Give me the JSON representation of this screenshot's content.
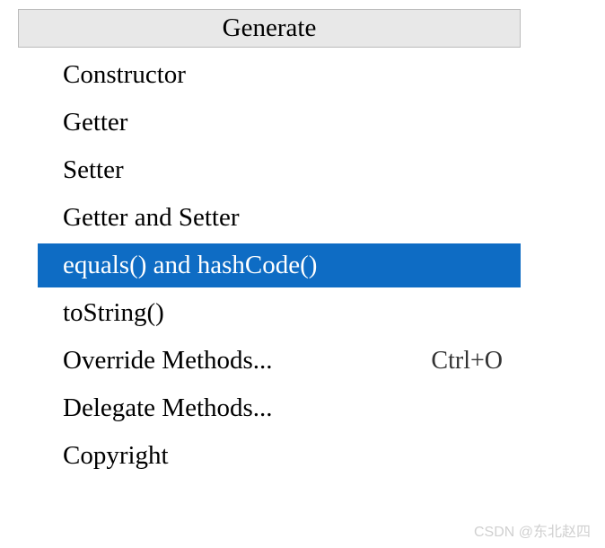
{
  "menu": {
    "title": "Generate",
    "items": [
      {
        "label": "Constructor",
        "shortcut": "",
        "selected": false
      },
      {
        "label": "Getter",
        "shortcut": "",
        "selected": false
      },
      {
        "label": "Setter",
        "shortcut": "",
        "selected": false
      },
      {
        "label": "Getter and Setter",
        "shortcut": "",
        "selected": false
      },
      {
        "label": "equals() and hashCode()",
        "shortcut": "",
        "selected": true
      },
      {
        "label": "toString()",
        "shortcut": "",
        "selected": false
      },
      {
        "label": "Override Methods...",
        "shortcut": "Ctrl+O",
        "selected": false
      },
      {
        "label": "Delegate Methods...",
        "shortcut": "",
        "selected": false
      },
      {
        "label": "Copyright",
        "shortcut": "",
        "selected": false
      }
    ]
  },
  "watermark": "CSDN @东北赵四"
}
